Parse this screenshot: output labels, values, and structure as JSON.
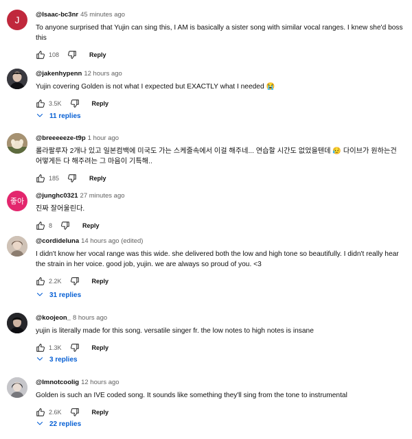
{
  "comments": [
    {
      "handle": "@Isaac-bc3nr",
      "time": "45 minutes ago",
      "text": "To anyone surprised that Yujin can sing this, I AM is basically a sister song with similar vocal ranges. I knew she'd boss this",
      "likes": "108",
      "reply_label": "Reply",
      "avatar_letter": "J",
      "avatar_color": "#c0283c"
    },
    {
      "handle": "@jakenhypenn",
      "time": "12 hours ago",
      "text": "Yujin covering Golden is not what I expected but EXACTLY what I needed 😭",
      "likes": "3.5K",
      "reply_label": "Reply",
      "replies_label": "11 replies"
    },
    {
      "handle": "@breeeeeze-t9p",
      "time": "1 hour ago",
      "text": "롤라팔루자 2개나 있고 일본컴백에 미국도 가는 스케줄속에서 이걸 해주네...  연습할 시간도 없었을텐데 😥  다이브가 원하는건 어떻게든 다 해주려는 그 마음이 기특해..",
      "likes": "185",
      "reply_label": "Reply"
    },
    {
      "handle": "@junghc0321",
      "time": "27 minutes ago",
      "text": "진짜 잘어울린다.",
      "likes": "8",
      "reply_label": "Reply",
      "avatar_letter": "좋아",
      "avatar_color": "#e3266d"
    },
    {
      "handle": "@cordideluna",
      "time": "14 hours ago (edited)",
      "text": "I didn't know her vocal range was this wide. she delivered both the low and high tone so beautifully. I didn't really hear the strain in her voice. good job, yujin. we are always so proud of you. <3",
      "likes": "2.2K",
      "reply_label": "Reply",
      "replies_label": "31 replies"
    },
    {
      "handle": "@koojeon_",
      "time": "8 hours ago",
      "text": "yujin is literally made for this song. versatile singer fr. the low notes to high notes is insane",
      "likes": "1.3K",
      "reply_label": "Reply",
      "replies_label": "3 replies"
    },
    {
      "handle": "@Imnotcoolig",
      "time": "12 hours ago",
      "text": "Golden is such an IVE coded song. It sounds like something they'll sing from the tone to instrumental",
      "likes": "2.6K",
      "reply_label": "Reply",
      "replies_label": "22 replies"
    }
  ],
  "colors": {
    "link": "#065fd4",
    "secondary_text": "#606060"
  }
}
